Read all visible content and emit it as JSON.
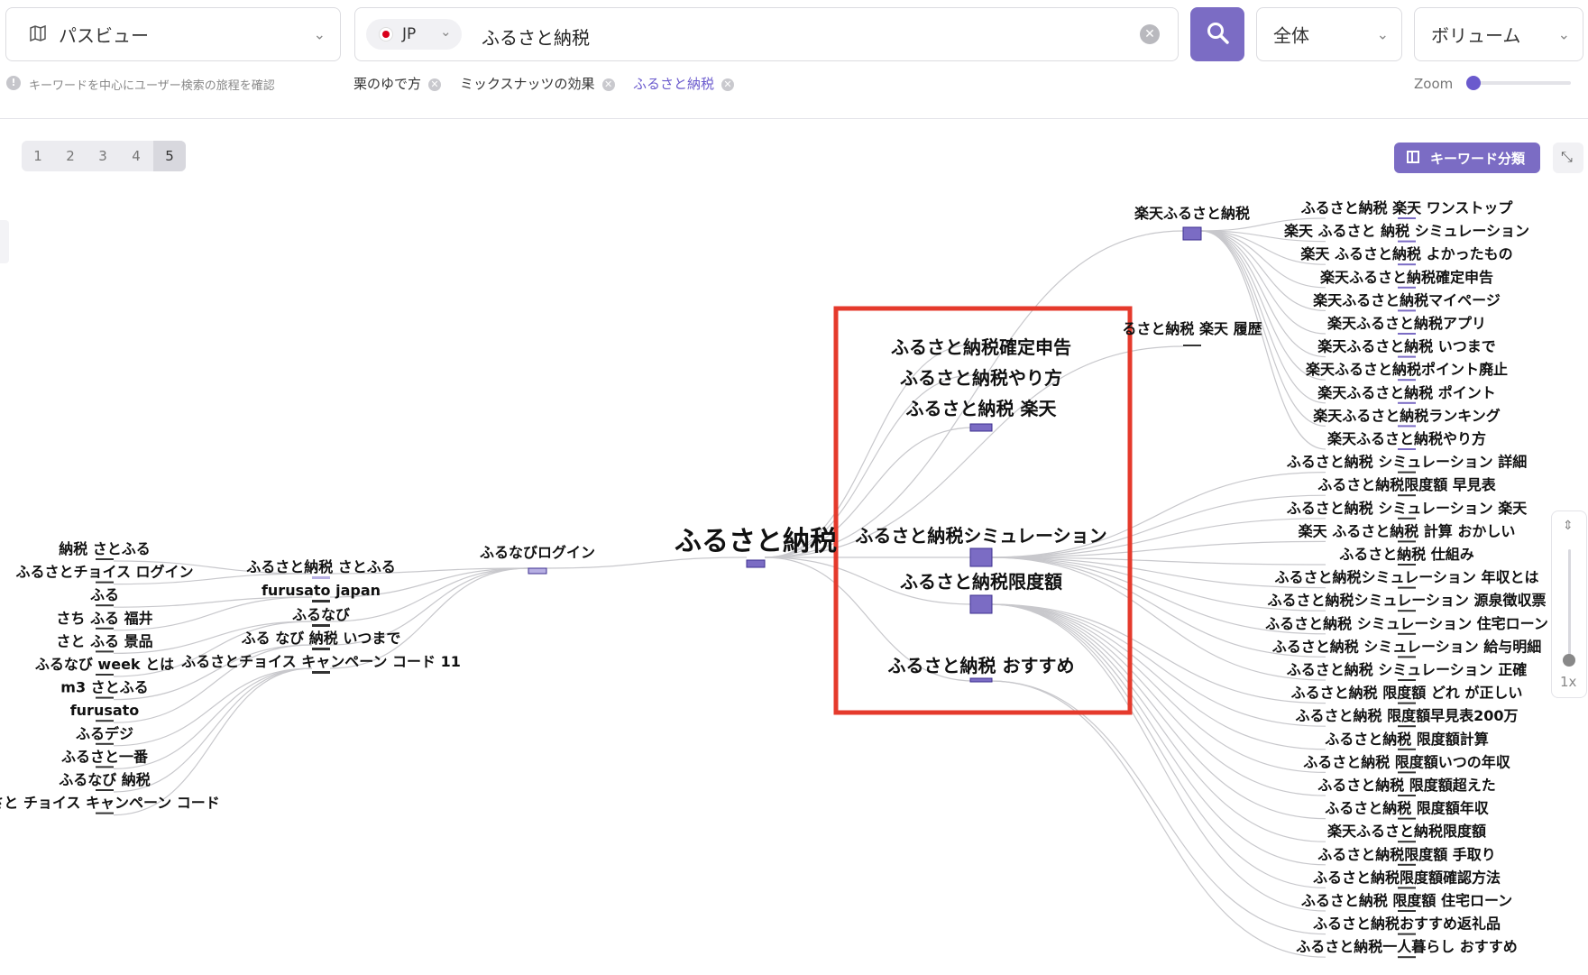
{
  "colors": {
    "accent": "#7b6cc4",
    "highlight": "#e53a2c",
    "node": "#7b6cc4"
  },
  "header": {
    "view_dropdown": {
      "icon": "map-icon",
      "label": "パスビュー"
    },
    "country": {
      "flag": "flag-jp-icon",
      "code": "JP"
    },
    "search": {
      "value": "ふるさと納税"
    },
    "scope_dropdown": {
      "label": "全体"
    },
    "sort_dropdown": {
      "label": "ボリューム"
    },
    "hint": "キーワードを中心にユーザー検索の旅程を確認",
    "chips": [
      {
        "label": "栗のゆで方",
        "active": false
      },
      {
        "label": "ミックスナッツの効果",
        "active": false
      },
      {
        "label": "ふるさと納税",
        "active": true
      }
    ],
    "zoom_label": "Zoom",
    "zoom_value": 0
  },
  "toolbar": {
    "pages": [
      "1",
      "2",
      "3",
      "4",
      "5"
    ],
    "active_page": "5",
    "classify_label": "キーワード分類",
    "zoom_level": "1x"
  },
  "graph": {
    "center": "ふるさと納税",
    "left_hop1": [
      "ふるなびログイン"
    ],
    "left_hop2": [
      "ふるさと納税 さとふる",
      "furusato japan",
      "ふるなび",
      "ふる なび 納税 いつまで",
      "ふるさとチョイス キャンペーン コード 11"
    ],
    "left_hop3": [
      "納税 さとふる",
      "ふるさとチョイス ログイン",
      "ふる",
      "さち ふる 福井",
      "さと ふる 景品",
      "ふるなび week とは",
      "m3 さとふる",
      "furusato",
      "ふるデジ",
      "ふるさと一番",
      "ふるなび 納税",
      "さと チョイス キャンペーン コード"
    ],
    "right_hop1": [
      "ふるさと納税確定申告",
      "ふるさと納税やり方",
      "ふるさと納税 楽天",
      "ふるさと納税シミュレーション",
      "ふるさと納税限度額",
      "ふるさと納税 おすすめ"
    ],
    "right_hop2": [
      "楽天ふるさと納税",
      "るさと納税 楽天 履歴"
    ],
    "right_hop3": [
      "ふるさと納税 楽天 ワンストップ",
      "楽天 ふるさと 納税 シミュレーション",
      "楽天 ふるさと納税 よかったもの",
      "楽天ふるさと納税確定申告",
      "楽天ふるさと納税マイページ",
      "楽天ふるさと納税アプリ",
      "楽天ふるさと納税 いつまで",
      "楽天ふるさと納税ポイント廃止",
      "楽天ふるさと納税 ポイント",
      "楽天ふるさと納税ランキング",
      "楽天ふるさと納税やり方",
      "ふるさと納税 シミュレーション 詳細",
      "ふるさと納税限度額 早見表",
      "ふるさと納税 シミュレーション 楽天",
      "楽天 ふるさと納税 計算 おかしい",
      "ふるさと納税 仕組み",
      "ふるさと納税シミュレーション 年収とは",
      "ふるさと納税シミュレーション 源泉徴収票",
      "ふるさと納税 シミュレーション 住宅ローン",
      "ふるさと納税 シミュレーション 給与明細",
      "ふるさと納税 シミュレーション 正確",
      "ふるさと納税 限度額 どれ が正しい",
      "ふるさと納税 限度額早見表200万",
      "ふるさと納税 限度額計算",
      "ふるさと納税 限度額いつの年収",
      "ふるさと納税 限度額超えた",
      "ふるさと納税 限度額年収",
      "楽天ふるさと納税限度額",
      "ふるさと納税限度額 手取り",
      "ふるさと納税限度額確認方法",
      "ふるさと納税 限度額 住宅ローン",
      "ふるさと納税おすすめ返礼品",
      "ふるさと納税一人暮らし おすすめ"
    ]
  }
}
